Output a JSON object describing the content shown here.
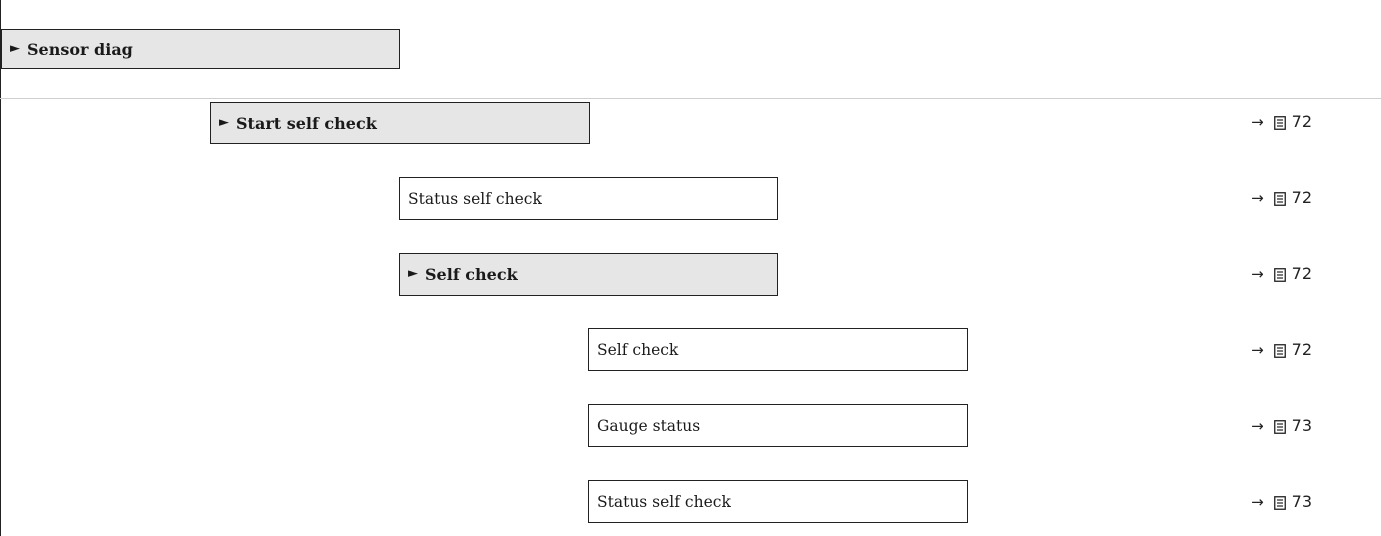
{
  "rows": [
    {
      "type": "menu",
      "label": "Sensor diag",
      "arrow": "►",
      "ref": ""
    },
    {
      "type": "menu",
      "label": "Start self check",
      "arrow": "►",
      "ref_arrow": "→",
      "ref": "72"
    },
    {
      "type": "param",
      "label": "Status self check",
      "ref_arrow": "→",
      "ref": "72"
    },
    {
      "type": "menu",
      "label": "Self check",
      "arrow": "►",
      "ref_arrow": "→",
      "ref": "72"
    },
    {
      "type": "param",
      "label": "Self check",
      "ref_arrow": "→",
      "ref": "72"
    },
    {
      "type": "param",
      "label": "Gauge status",
      "ref_arrow": "→",
      "ref": "73"
    },
    {
      "type": "param",
      "label": "Status self check",
      "ref_arrow": "→",
      "ref": "73"
    }
  ]
}
